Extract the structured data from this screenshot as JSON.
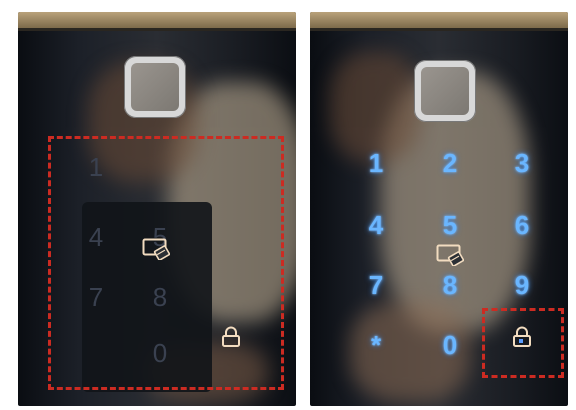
{
  "left_panel": {
    "keypad_visible": false,
    "faint_keys": [
      "1",
      "4",
      "7",
      "5",
      "8",
      "0"
    ]
  },
  "right_panel": {
    "keypad_visible": true,
    "keys": [
      "1",
      "2",
      "3",
      "4",
      "5",
      "6",
      "7",
      "8",
      "9",
      "*",
      "0"
    ]
  },
  "icons": {
    "fingerprint_sensor": "fingerprint-sensor-icon",
    "card_reader": "card-icon",
    "lock": "padlock-icon"
  },
  "colors": {
    "highlight_border": "#cc2b22",
    "key_glow": "#6ab6ff",
    "icon_color": "#f2dcc0",
    "trim": "#b9a27a"
  }
}
